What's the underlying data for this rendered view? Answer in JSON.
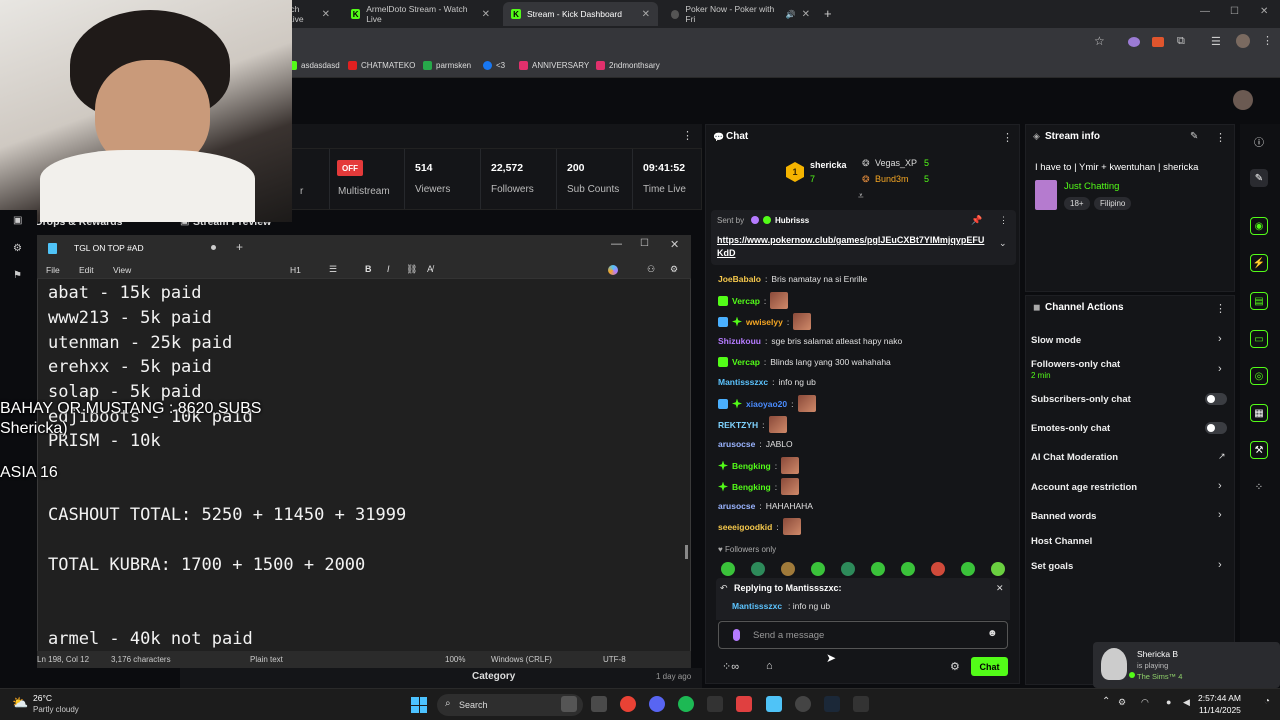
{
  "browser": {
    "tabs": [
      {
        "label": "tch Live"
      },
      {
        "label": "ArmelDoto Stream - Watch Live"
      },
      {
        "label": "Stream - Kick Dashboard"
      },
      {
        "label": "Poker Now - Poker with Fri"
      }
    ],
    "new_tab": "+",
    "bookmarks": [
      "asdasdasd",
      "CHATMATEKO",
      "parmsken",
      "<3",
      "ANNIVERSARY",
      "2ndmonthsary"
    ]
  },
  "dashboard": {
    "off_badge": "OFF",
    "sidebar_item": "Drops & Rewards",
    "stream_preview": "Stream Preview",
    "stats": [
      {
        "value": "",
        "label": "Multistream"
      },
      {
        "value": "514",
        "label": "Viewers"
      },
      {
        "value": "22,572",
        "label": "Followers"
      },
      {
        "value": "200",
        "label": "Sub Counts"
      },
      {
        "value": "09:41:52",
        "label": "Time Live"
      }
    ],
    "category_label": "Category",
    "category_time": "1 day ago",
    "partial_letter": "r"
  },
  "chat": {
    "title": "Chat",
    "leader_rank": "1",
    "leaders": [
      {
        "name": "shericka",
        "count": "7"
      },
      {
        "name": "Vegas_XP",
        "count": "5"
      },
      {
        "name": "Bund3m",
        "count": "5"
      }
    ],
    "pinned_by_label": "Sent by",
    "pinned_by": "Hubrisss",
    "pinned_link": "https://www.pokernow.club/games/pglJEuCXBt7YIMmjqypEFUKdD",
    "messages": [
      {
        "user": "JoeBabalo",
        "text": "Bris namatay na si Enrille",
        "color": "#f5c84c"
      },
      {
        "user": "Vercap",
        "text": "",
        "color": "#53fc18"
      },
      {
        "user": "wwiselyy",
        "text": "",
        "color": "#f5a623"
      },
      {
        "user": "Shizukouu",
        "text": "sge bris salamat atleast hapy nako",
        "color": "#b57bff"
      },
      {
        "user": "Vercap",
        "text": "Blinds lang yang 300 wahahaha",
        "color": "#53fc18"
      },
      {
        "user": "Mantissszxc",
        "text": "info ng ub",
        "color": "#5cc4ff"
      },
      {
        "user": "xiaoyao20",
        "text": "",
        "color": "#4a8cff"
      },
      {
        "user": "REKTZYH",
        "text": "",
        "color": "#7fd3ff"
      },
      {
        "user": "arusocse",
        "text": "JABLO",
        "color": "#9ab4ff"
      },
      {
        "user": "Bengking",
        "text": "",
        "color": "#53fc18"
      },
      {
        "user": "Bengking",
        "text": "",
        "color": "#53fc18"
      },
      {
        "user": "arusocse",
        "text": "HAHAHAHA",
        "color": "#9ab4ff"
      },
      {
        "user": "seeeigoodkid",
        "text": "",
        "color": "#f5c84c"
      }
    ],
    "followers_only": "Followers only",
    "replying_to": "Replying to Mantissszxc:",
    "reply_user": "Mantissszxc",
    "reply_text": "info ng ub",
    "input_placeholder": "Send a message",
    "send_button": "Chat"
  },
  "stream_info": {
    "title": "Stream info",
    "stream_title": "I have to | Ymir + kwentuhan | shericka",
    "category": "Just Chatting",
    "tags": [
      "18+",
      "Filipino"
    ]
  },
  "channel_actions": {
    "title": "Channel Actions",
    "items": [
      {
        "label": "Slow mode",
        "sub": ""
      },
      {
        "label": "Followers-only chat",
        "sub": "2 min"
      },
      {
        "label": "Subscribers-only chat",
        "sub": ""
      },
      {
        "label": "Emotes-only chat",
        "sub": ""
      },
      {
        "label": "AI Chat Moderation",
        "sub": ""
      },
      {
        "label": "Account age restriction",
        "sub": ""
      },
      {
        "label": "Banned words",
        "sub": ""
      },
      {
        "label": "Host Channel",
        "sub": ""
      },
      {
        "label": "Set goals",
        "sub": ""
      }
    ]
  },
  "notepad": {
    "tab_title": "TGL ON TOP #AD",
    "menu": [
      "File",
      "Edit",
      "View"
    ],
    "heading": "H1",
    "lines": [
      "abat - 15k paid",
      "www213 - 5k paid",
      "utenman - 25k paid",
      "erehxx - 5k paid",
      "solap - 5k paid",
      "edjiboots - 10k paid",
      "PRISM - 10k",
      "",
      "",
      "CASHOUT TOTAL: 5250 + 11450 + 31999",
      "",
      "TOTAL KUBRA: 1700 + 1500 + 2000",
      "",
      "",
      "armel - 40k not paid"
    ],
    "status": {
      "position": "Ln 198, Col 12",
      "chars": "3,176 characters",
      "format": "Plain text",
      "zoom": "100%",
      "eol": "Windows (CRLF)",
      "encoding": "UTF-8"
    }
  },
  "overlay": {
    "goal_line": "BAHAY OR MUSTANG : 8620 SUBS",
    "name_line": "Shericka)",
    "asia_line": "ASIA 16"
  },
  "now_playing": {
    "name": "Shericka B",
    "status": "is playing",
    "game": "The Sims™ 4"
  },
  "taskbar": {
    "weather_temp": "26°C",
    "weather_desc": "Partly cloudy",
    "search": "Search",
    "time": "2:57:44 AM",
    "date": "11/14/2025"
  }
}
